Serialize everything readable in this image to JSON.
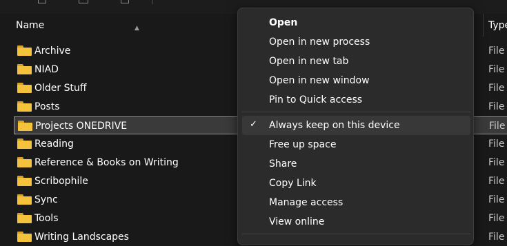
{
  "header": {
    "name_label": "Name",
    "type_label": "Type"
  },
  "files": [
    {
      "name": "Archive",
      "type": "File"
    },
    {
      "name": "NIAD",
      "type": "File"
    },
    {
      "name": "Older Stuff",
      "type": "File"
    },
    {
      "name": "Posts",
      "type": "File"
    },
    {
      "name": "Projects ONEDRIVE",
      "type": "File",
      "selected": true
    },
    {
      "name": "Reading",
      "type": "File"
    },
    {
      "name": "Reference & Books on Writing",
      "type": "File"
    },
    {
      "name": "Scribophile",
      "type": "File"
    },
    {
      "name": "Sync",
      "type": "File"
    },
    {
      "name": "Tools",
      "type": "File"
    },
    {
      "name": "Writing Landscapes",
      "type": "File"
    }
  ],
  "context_menu": {
    "items": [
      {
        "label": "Open"
      },
      {
        "label": "Open in new process"
      },
      {
        "label": "Open in new tab"
      },
      {
        "label": "Open in new window"
      },
      {
        "label": "Pin to Quick access"
      },
      {
        "label": "Always keep on this device",
        "checked": true
      },
      {
        "label": "Free up space"
      },
      {
        "label": "Share"
      },
      {
        "label": "Copy Link"
      },
      {
        "label": "Manage access"
      },
      {
        "label": "View online"
      }
    ]
  },
  "colors": {
    "background": "#191919",
    "menu_background": "#2b2b2b",
    "folder_yellow": "#f5c33b",
    "selection": "#3a3a3a"
  },
  "icons": [
    "folder-icon",
    "checkmark-icon",
    "sort-up-icon"
  ]
}
